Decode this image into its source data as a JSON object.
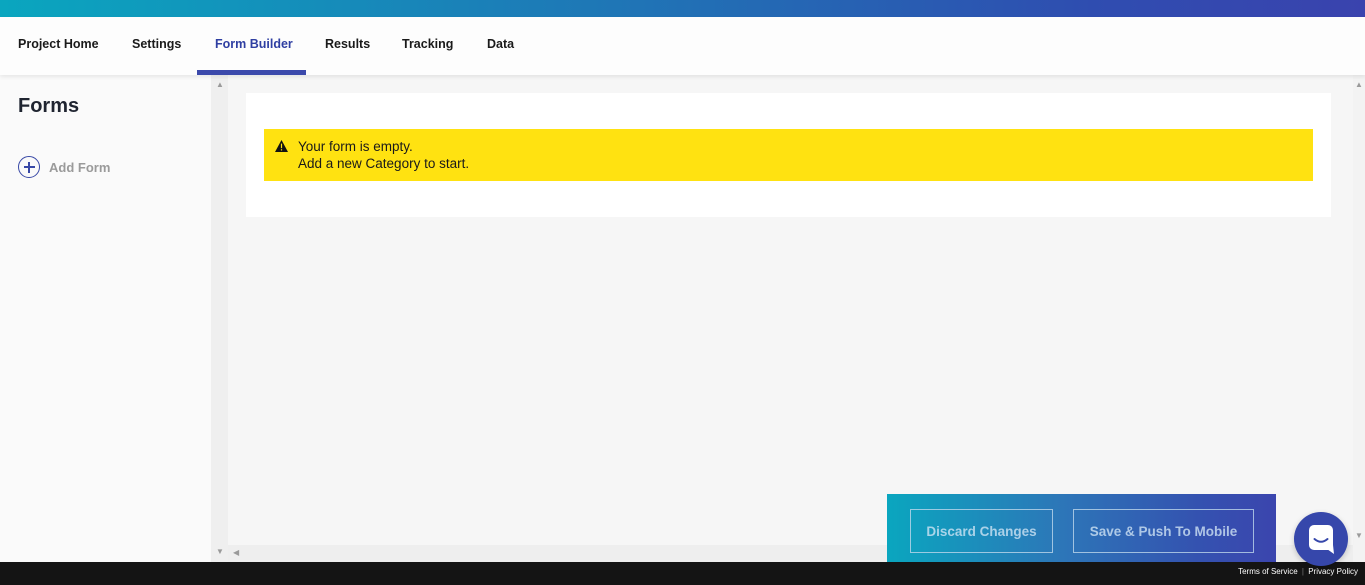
{
  "nav": {
    "tabs": [
      {
        "label": "Project Home",
        "active": false
      },
      {
        "label": "Settings",
        "active": false
      },
      {
        "label": "Form Builder",
        "active": true
      },
      {
        "label": "Results",
        "active": false
      },
      {
        "label": "Tracking",
        "active": false
      },
      {
        "label": "Data",
        "active": false
      }
    ]
  },
  "sidebar": {
    "title": "Forms",
    "add_form_label": "Add Form",
    "add_form_icon": "plus-circle-icon"
  },
  "main": {
    "alert": {
      "icon": "warning-icon",
      "line1": "Your form is empty.",
      "line2": "Add a new Category to start.",
      "color": "#ffe211"
    }
  },
  "actions": {
    "discard_label": "Discard Changes",
    "save_label": "Save & Push To Mobile"
  },
  "chat": {
    "icon": "chat-icon"
  },
  "footer": {
    "terms_label": "Terms of Service",
    "separator": "|",
    "privacy_label": "Privacy Policy"
  },
  "colors": {
    "accent": "#3b49ab",
    "gradient_start": "#0aa6bf",
    "gradient_end": "#3a43ae",
    "footer": "#141414"
  }
}
